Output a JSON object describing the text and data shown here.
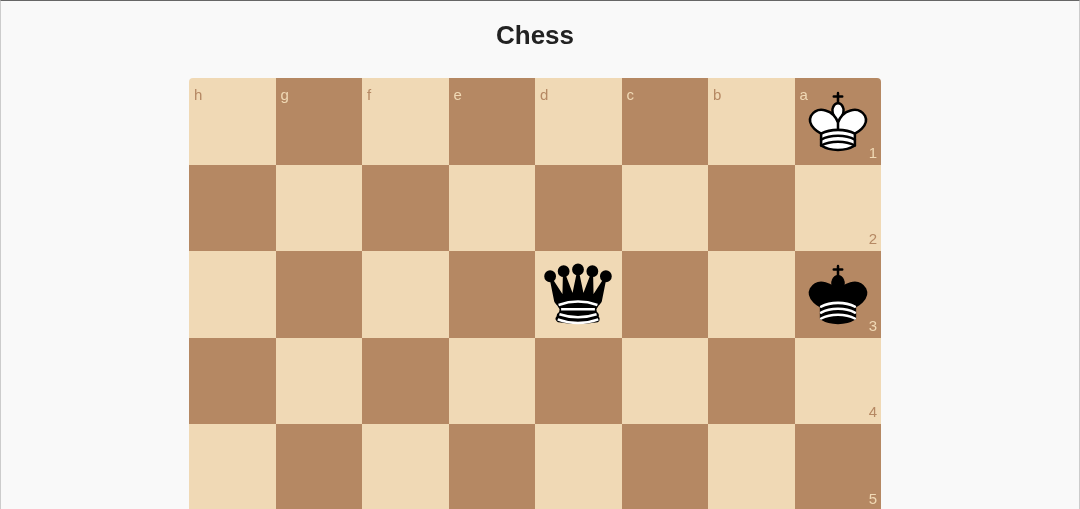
{
  "title": "Chess",
  "files": [
    "h",
    "g",
    "f",
    "e",
    "d",
    "c",
    "b",
    "a"
  ],
  "ranks": [
    {
      "label": "1",
      "squares": [
        {
          "kind": "empty"
        },
        {
          "kind": "empty"
        },
        {
          "kind": "empty"
        },
        {
          "kind": "empty"
        },
        {
          "kind": "empty"
        },
        {
          "kind": "empty"
        },
        {
          "kind": "empty"
        },
        {
          "kind": "white_king"
        }
      ]
    },
    {
      "label": "2",
      "squares": [
        {
          "kind": "empty"
        },
        {
          "kind": "empty"
        },
        {
          "kind": "empty"
        },
        {
          "kind": "empty"
        },
        {
          "kind": "empty"
        },
        {
          "kind": "empty"
        },
        {
          "kind": "empty"
        },
        {
          "kind": "empty"
        }
      ]
    },
    {
      "label": "3",
      "squares": [
        {
          "kind": "empty"
        },
        {
          "kind": "empty"
        },
        {
          "kind": "empty"
        },
        {
          "kind": "empty"
        },
        {
          "kind": "black_queen"
        },
        {
          "kind": "empty"
        },
        {
          "kind": "empty"
        },
        {
          "kind": "black_king"
        }
      ]
    },
    {
      "label": "4",
      "squares": [
        {
          "kind": "empty"
        },
        {
          "kind": "empty"
        },
        {
          "kind": "empty"
        },
        {
          "kind": "empty"
        },
        {
          "kind": "empty"
        },
        {
          "kind": "empty"
        },
        {
          "kind": "empty"
        },
        {
          "kind": "empty"
        }
      ]
    },
    {
      "label": "5",
      "squares": [
        {
          "kind": "empty"
        },
        {
          "kind": "empty"
        },
        {
          "kind": "empty"
        },
        {
          "kind": "empty"
        },
        {
          "kind": "empty"
        },
        {
          "kind": "empty"
        },
        {
          "kind": "empty"
        },
        {
          "kind": "empty"
        }
      ]
    }
  ]
}
